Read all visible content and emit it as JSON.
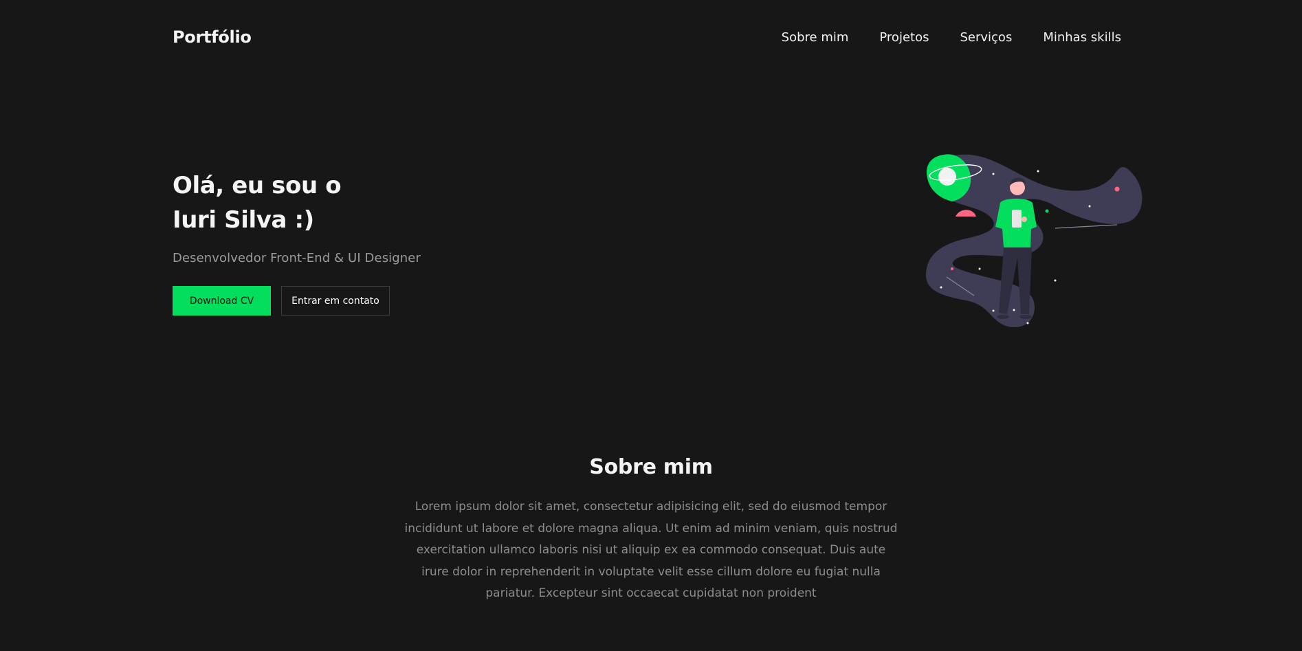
{
  "header": {
    "logo": "Portfólio",
    "nav": [
      "Sobre mim",
      "Projetos",
      "Serviços",
      "Minhas skills"
    ]
  },
  "hero": {
    "title_line1": "Olá, eu sou o",
    "title_line2": "Iuri Silva :)",
    "subtitle": "Desenvolvedor Front-End & UI Designer",
    "download_button": "Download CV",
    "contact_button": "Entrar em contato"
  },
  "about": {
    "title": "Sobre mim",
    "text": "Lorem ipsum dolor sit amet, consectetur adipisicing elit, sed do eiusmod tempor incididunt ut labore et dolore magna aliqua. Ut enim ad minim veniam, quis nostrud exercitation ullamco laboris nisi ut aliquip ex ea commodo consequat. Duis aute irure dolor in reprehenderit in voluptate velit esse cillum dolore eu fugiat nulla pariatur. Excepteur sint occaecat cupidatat non proident"
  },
  "colors": {
    "background": "#171717",
    "accent": "#03de5c",
    "text_muted": "#9b9b9b",
    "illustration_blob": "#3f3d56",
    "illustration_pink": "#ff6584"
  }
}
